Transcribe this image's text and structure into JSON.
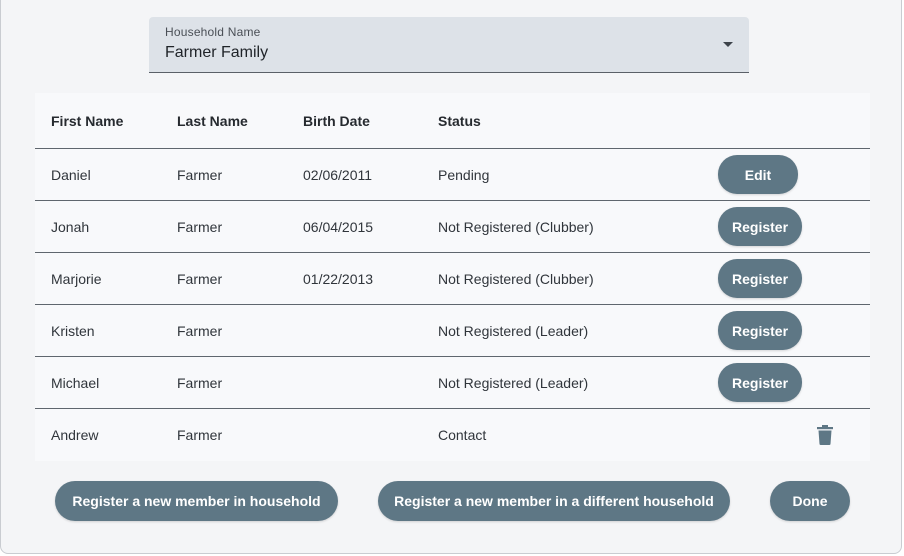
{
  "household_select": {
    "label": "Household Name",
    "value": "Farmer Family"
  },
  "table": {
    "headers": {
      "first_name": "First Name",
      "last_name": "Last Name",
      "birth_date": "Birth Date",
      "status": "Status"
    },
    "rows": [
      {
        "first_name": "Daniel",
        "last_name": "Farmer",
        "birth_date": "02/06/2011",
        "status": "Pending",
        "action": "Edit"
      },
      {
        "first_name": "Jonah",
        "last_name": "Farmer",
        "birth_date": "06/04/2015",
        "status": "Not Registered (Clubber)",
        "action": "Register"
      },
      {
        "first_name": "Marjorie",
        "last_name": "Farmer",
        "birth_date": "01/22/2013",
        "status": "Not Registered (Clubber)",
        "action": "Register"
      },
      {
        "first_name": "Kristen",
        "last_name": "Farmer",
        "birth_date": "",
        "status": "Not Registered (Leader)",
        "action": "Register"
      },
      {
        "first_name": "Michael",
        "last_name": "Farmer",
        "birth_date": "",
        "status": "Not Registered (Leader)",
        "action": "Register"
      },
      {
        "first_name": "Andrew",
        "last_name": "Farmer",
        "birth_date": "",
        "status": "Contact",
        "action_icon": "trash-icon"
      }
    ]
  },
  "footer": {
    "register_new_member": "Register a new member in household",
    "register_different_household": "Register a new member in a different household",
    "done": "Done"
  },
  "colors": {
    "button": "#5e7785",
    "select_background": "#dde2e8",
    "table_background": "#f8f9fb"
  }
}
